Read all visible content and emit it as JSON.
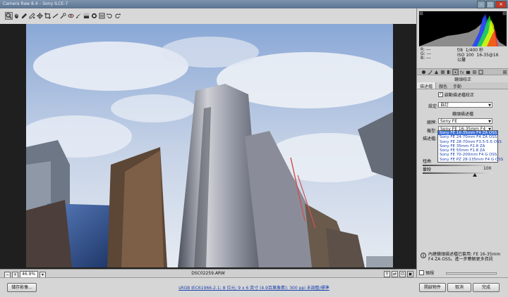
{
  "window": {
    "title": "Camera Raw 8.4 – Sony ILCE-7",
    "controls": [
      "–",
      "□",
      "✕"
    ]
  },
  "toolbar": {
    "tools": [
      "zoom-icon",
      "hand-icon",
      "white-balance-icon",
      "color-sampler-icon",
      "targeted-adjustment-icon",
      "crop-icon",
      "straighten-icon",
      "spot-removal-icon",
      "red-eye-icon",
      "adjustment-brush-icon",
      "graduated-filter-icon",
      "radial-filter-icon",
      "preferences-icon",
      "rotate-left-icon",
      "rotate-right-icon"
    ]
  },
  "preview": {
    "zoom": "46.9%",
    "filename": "DSC02259.ARW"
  },
  "histogram": {
    "colors": [
      "#ff2020",
      "#20ff20",
      "#2040ff",
      "#ffff00"
    ]
  },
  "info": {
    "r": "R: ---",
    "g": "G: ---",
    "b": "B: ---",
    "aperture": "f/8",
    "shutter": "1/400 秒",
    "iso": "ISO 100",
    "lens": "16-35@16 公釐"
  },
  "panel": {
    "name": "鏡頭校正",
    "subtabs": [
      "描述檔",
      "顏色",
      "手動"
    ],
    "enable_profile": "啟動描述檔校正",
    "setup_label": "設定:",
    "setup_value": "自訂",
    "section_title": "鏡頭描述檔",
    "make_label": "廠牌:",
    "make_value": "Sony FE",
    "model_label": "機型:",
    "model_value": "Sony FE 16-35mm F4 ZA ...",
    "profile_label": "描述檔:",
    "distortion_label": "扭曲",
    "vignetting_label": "暈映",
    "vignetting_value": "100"
  },
  "lens_options": [
    "Sony FE 16-35mm F4 ZA OSS",
    "Sony FE 24-70mm F4 ZA OSS",
    "Sony FE 28-70mm F3.5-5.6 OSS",
    "Sony FE 35mm F2.8 ZA",
    "Sony FE 55mm F1.8 ZA",
    "Sony FE 70-200mm F4 G OSS",
    "Sony FE PZ 28-135mm F4 G OSS"
  ],
  "notice": "內建鏡頭描述檔已套用: FE 16-35mm F4 ZA OSS。進一步瞭解更多資訊",
  "preview_toggle": "預視",
  "footer": {
    "save": "儲存影像...",
    "workflow": "sRGB IEC61966-2.1; 8 位元; 9 x 6 英寸 (4.9百萬像素); 300 ppi 未調整/標準",
    "open": "開啟物件",
    "cancel": "取消",
    "done": "完成"
  }
}
